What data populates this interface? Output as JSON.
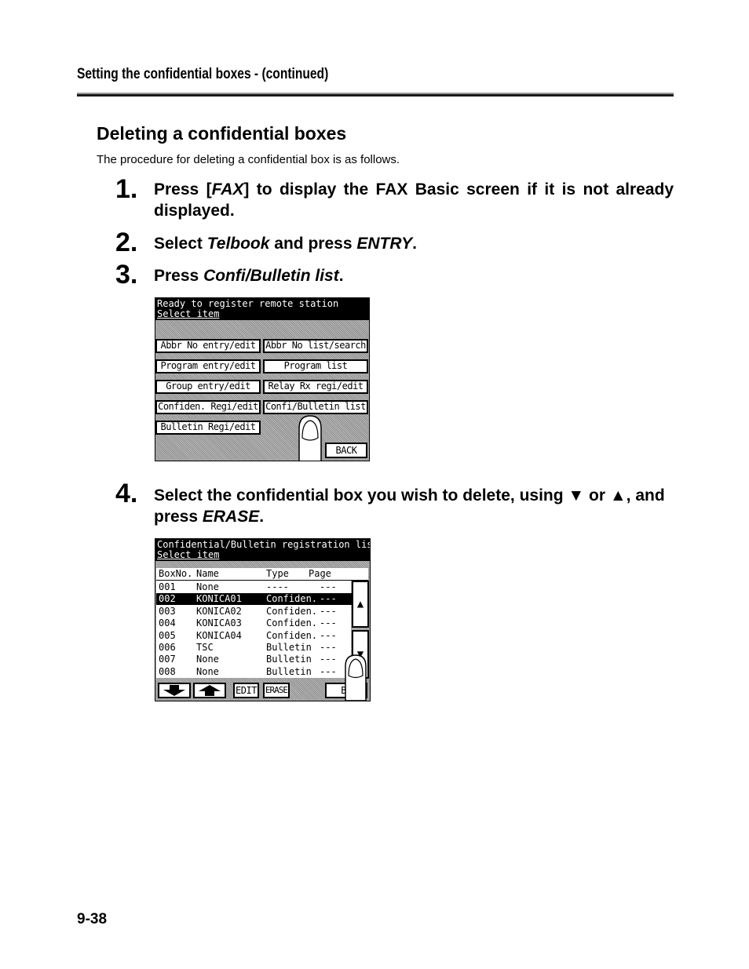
{
  "header": {
    "section_title": "Setting the confidential boxes -  (continued)"
  },
  "main": {
    "heading": "Deleting a confidential boxes",
    "intro": "The procedure for deleting a confidential box is as follows.",
    "steps": [
      {
        "number": "1.",
        "parts": [
          "Press [",
          "FAX",
          "] to display the FAX Basic screen if it is not already displayed."
        ]
      },
      {
        "number": "2.",
        "parts": [
          "Select ",
          "Telbook",
          " and press ",
          "ENTRY",
          "."
        ]
      },
      {
        "number": "3.",
        "parts": [
          "Press ",
          "Confi/Bulletin list",
          "."
        ]
      },
      {
        "number": "4.",
        "parts": [
          "Select the confidential box you wish to delete, using ▼ or ▲, and press ",
          "ERASE",
          "."
        ]
      }
    ]
  },
  "screen1": {
    "header_line1": "Ready to register remote station",
    "header_line2": "Select item",
    "buttons": [
      "Abbr No entry/edit",
      "Abbr No list/search",
      "Program entry/edit",
      "Program list",
      "Group entry/edit",
      "Relay Rx regi/edit",
      "Confiden. Regi/edit",
      "Confi/Bulletin list",
      "Bulletin Regi/edit"
    ],
    "back": "BACK"
  },
  "screen2": {
    "header_line1": "Confidential/Bulletin registration list",
    "header_line2": "Select item",
    "columns": [
      "BoxNo.",
      "Name",
      "Type",
      "Page"
    ],
    "rows": [
      {
        "box": "001",
        "name": "None",
        "type": "----",
        "page": "---"
      },
      {
        "box": "002",
        "name": "KONICA01",
        "type": "Confiden.",
        "page": "---",
        "selected": true
      },
      {
        "box": "003",
        "name": "KONICA02",
        "type": "Confiden.",
        "page": "---"
      },
      {
        "box": "004",
        "name": "KONICA03",
        "type": "Confiden.",
        "page": "---"
      },
      {
        "box": "005",
        "name": "KONICA04",
        "type": "Confiden.",
        "page": "---"
      },
      {
        "box": "006",
        "name": "TSC",
        "type": "Bulletin",
        "page": "---"
      },
      {
        "box": "007",
        "name": "None",
        "type": "Bulletin",
        "page": "---"
      },
      {
        "box": "008",
        "name": "None",
        "type": "Bulletin",
        "page": "---"
      }
    ],
    "scroll_up": "▲",
    "scroll_down": "▼",
    "edit": "EDIT",
    "erase": "ERASE",
    "back": "BA"
  },
  "footer": {
    "page_number": "9-38"
  }
}
